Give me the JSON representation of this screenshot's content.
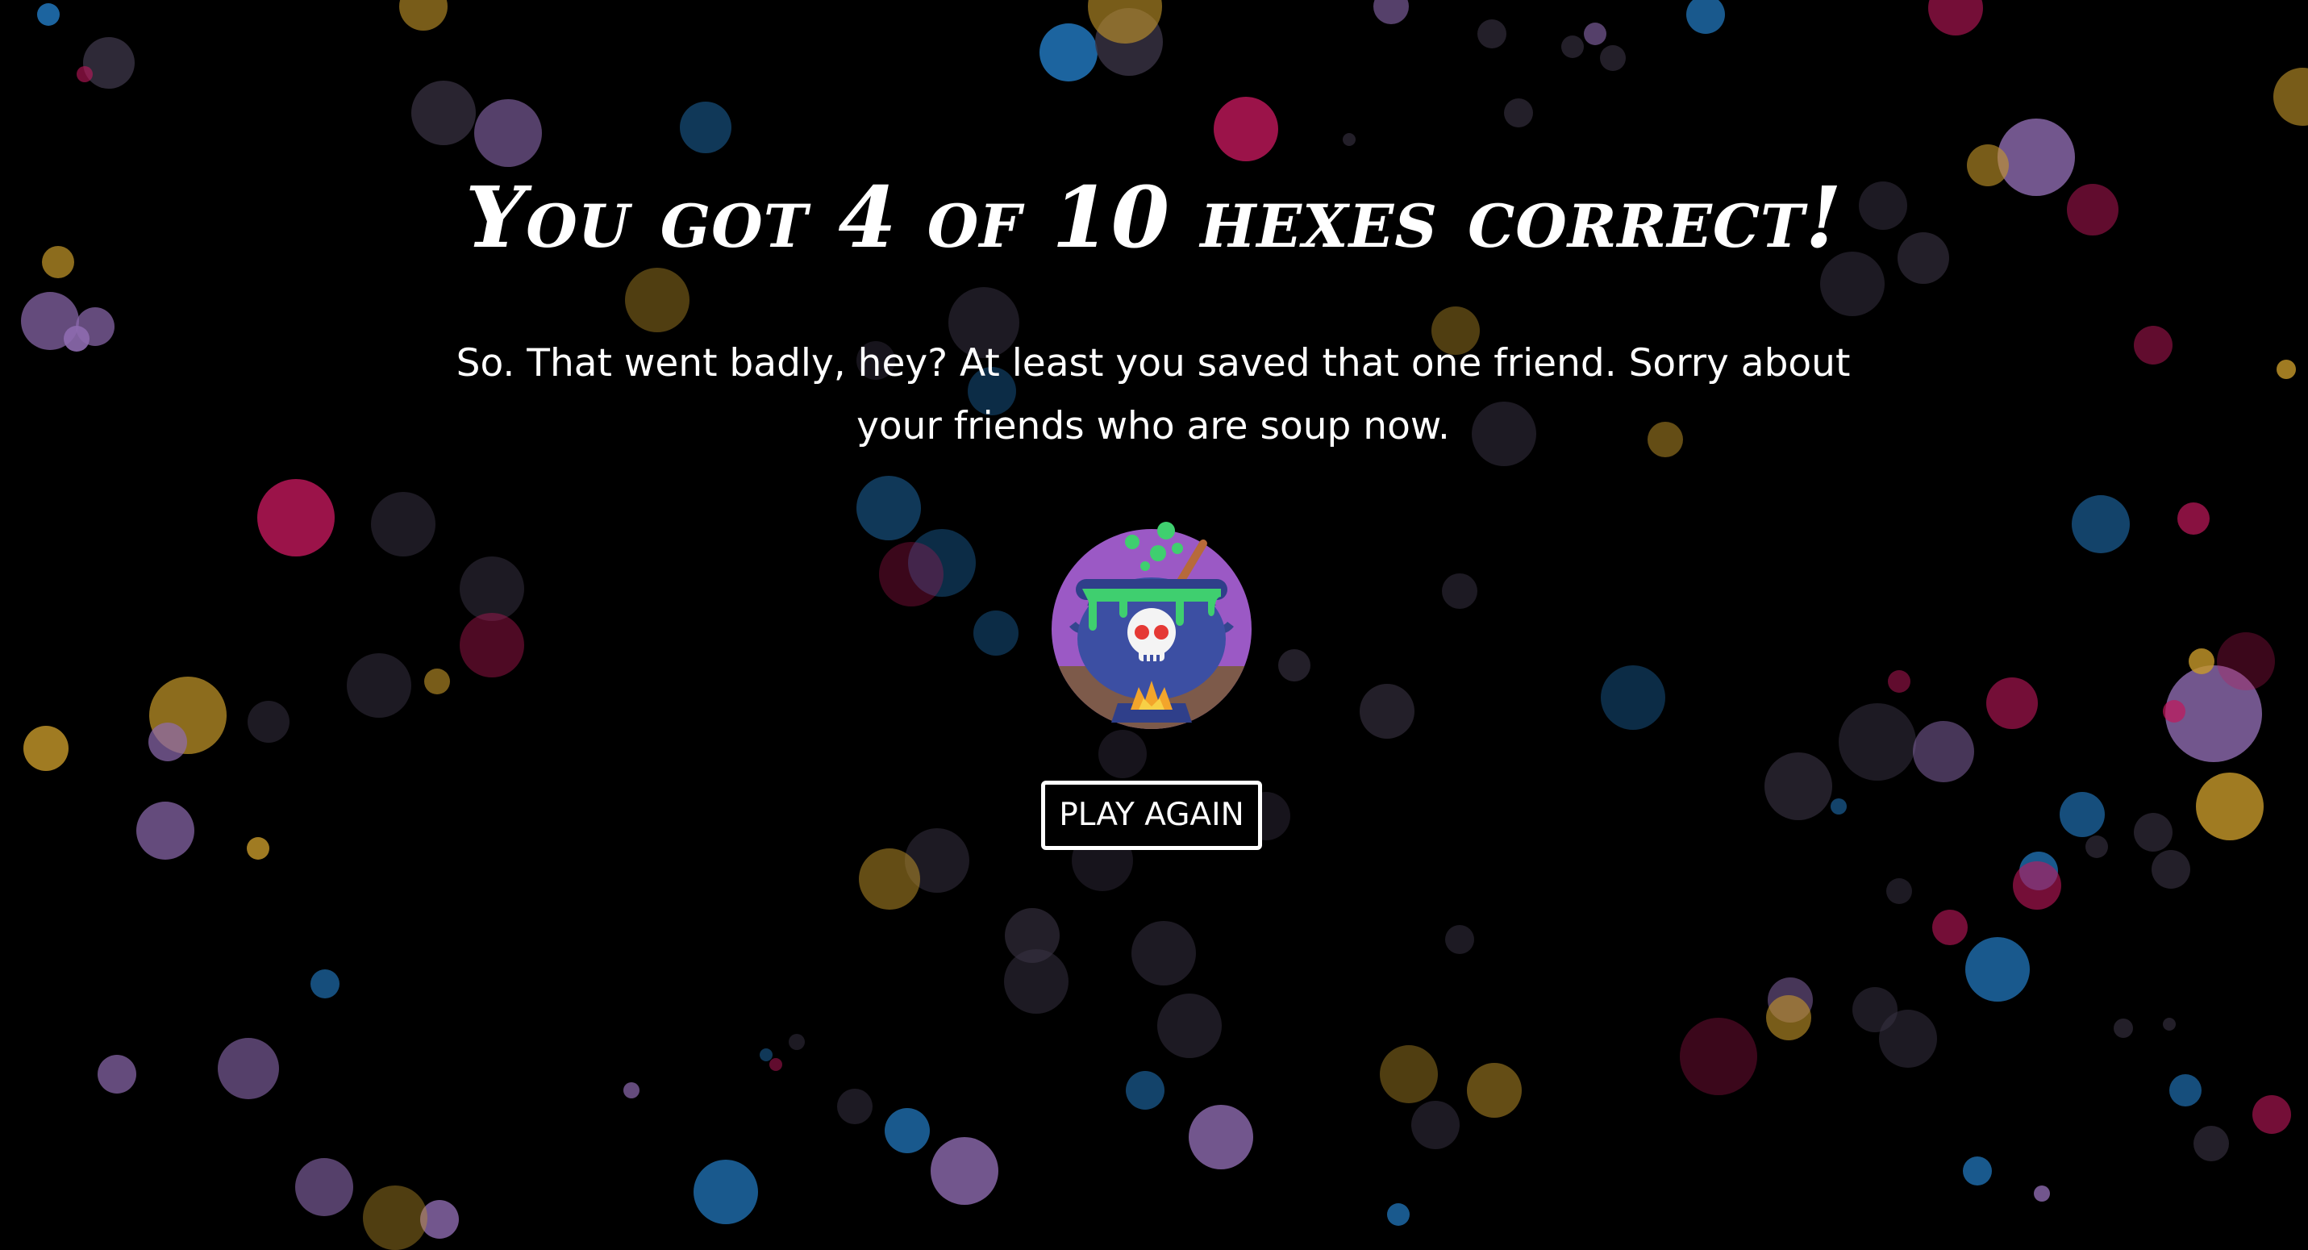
{
  "result": {
    "title": "You got 4 of 10 hexes correct!",
    "message": "So. That went badly, hey? At least you saved that one friend. Sorry about your friends who are soup now.",
    "image_icon": "cauldron-skull-icon"
  },
  "actions": {
    "play_again_label": "PLAY AGAIN"
  },
  "colors": {
    "background": "#000000",
    "text": "#ffffff",
    "bokeh_purple": "#8e6bb0",
    "bokeh_blue": "#1f6fb0",
    "bokeh_gold": "#c89a2a",
    "bokeh_magenta": "#c2185b",
    "bokeh_dark": "#3a3345"
  }
}
